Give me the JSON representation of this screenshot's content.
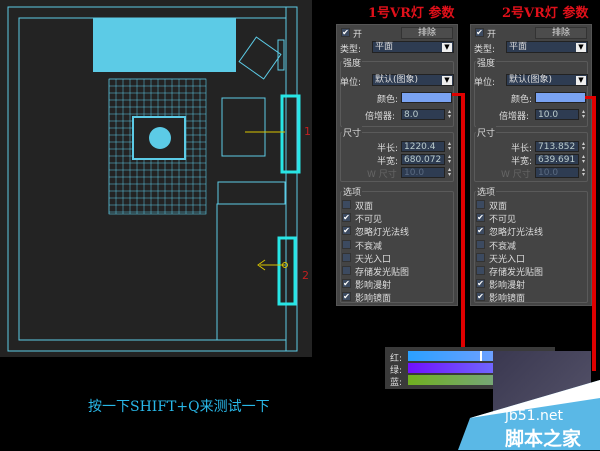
{
  "viewport": {
    "light_labels": [
      "1",
      "2"
    ]
  },
  "caption": "按一下SHIFT+Q来测试一下",
  "panels": [
    {
      "title": "1号VR灯 参数",
      "on_label": "开",
      "on_checked": true,
      "exclude_label": "排除",
      "type_label": "类型:",
      "type_value": "平面",
      "intensity_label": "强度",
      "units_label": "单位:",
      "units_value": "默认(图象)",
      "color_label": "颜色:",
      "color": "#7aa3f2",
      "multiplier_label": "倍增器:",
      "multiplier": "8.0",
      "size_label": "尺寸",
      "half_length_label": "半长:",
      "half_length": "1220.4",
      "half_width_label": "半宽:",
      "half_width": "680.072",
      "w_size_label": "W 尺寸",
      "w_size": "10.0",
      "options_label": "选项",
      "options": [
        {
          "label": "双面",
          "checked": false
        },
        {
          "label": "不可见",
          "checked": true
        },
        {
          "label": "忽略灯光法线",
          "checked": true
        },
        {
          "label": "不衰减",
          "checked": false
        },
        {
          "label": "天光入口",
          "checked": false
        },
        {
          "label": "存储发光贴图",
          "checked": false
        },
        {
          "label": "影响漫射",
          "checked": true
        },
        {
          "label": "影响镜面",
          "checked": true
        }
      ]
    },
    {
      "title": "2号VR灯 参数",
      "on_label": "开",
      "on_checked": true,
      "exclude_label": "排除",
      "type_label": "类型:",
      "type_value": "平面",
      "intensity_label": "强度",
      "units_label": "单位:",
      "units_value": "默认(图象)",
      "color_label": "颜色:",
      "color": "#7aa3f2",
      "multiplier_label": "倍增器:",
      "multiplier": "10.0",
      "size_label": "尺寸",
      "half_length_label": "半长:",
      "half_length": "713.852",
      "half_width_label": "半宽:",
      "half_width": "639.691",
      "w_size_label": "W 尺寸",
      "w_size": "10.0",
      "options_label": "选项",
      "options": [
        {
          "label": "双面",
          "checked": false
        },
        {
          "label": "不可见",
          "checked": true
        },
        {
          "label": "忽略灯光法线",
          "checked": true
        },
        {
          "label": "不衰减",
          "checked": false
        },
        {
          "label": "天光入口",
          "checked": false
        },
        {
          "label": "存储发光贴图",
          "checked": false
        },
        {
          "label": "影响漫射",
          "checked": true
        },
        {
          "label": "影响镜面",
          "checked": true
        }
      ]
    }
  ],
  "color_picker": {
    "red_label": "红:",
    "green_label": "绿:",
    "blue_label": "蓝:",
    "red": 0.5,
    "green": 0.65
  },
  "watermark": {
    "url": "jb51.net",
    "name": "脚本之家"
  },
  "colors": {
    "accent_red": "#e00000",
    "cad_cyan": "#5ccbe6",
    "caption": "#29b8e8"
  }
}
